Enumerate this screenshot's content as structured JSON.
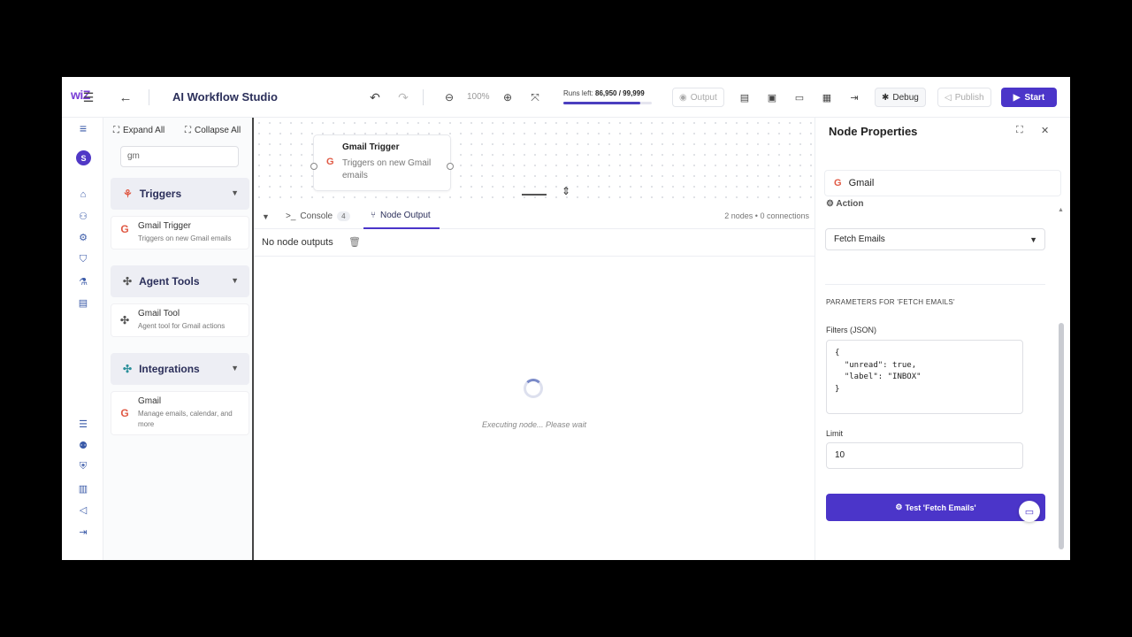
{
  "header": {
    "logo": "wiZ",
    "title": "AI Workflow Studio",
    "zoom": "100%",
    "runs_label": "Runs left:",
    "runs_value": "86,950 / 99,999",
    "runs_fraction": 0.87,
    "output_label": "Output",
    "debug_label": "Debug",
    "publish_label": "Publish",
    "start_label": "Start"
  },
  "rail": {
    "avatar_letter": "S"
  },
  "library": {
    "expand_all": "Expand All",
    "collapse_all": "Collapse All",
    "search_value": "gm",
    "categories": [
      {
        "label": "Triggers",
        "item_name": "Gmail Trigger",
        "item_desc": "Triggers on new Gmail emails"
      },
      {
        "label": "Agent Tools",
        "item_name": "Gmail Tool",
        "item_desc": "Agent tool for Gmail actions"
      },
      {
        "label": "Integrations",
        "item_name": "Gmail",
        "item_desc": "Manage emails, calendar, and more"
      }
    ]
  },
  "canvas": {
    "node_title": "Gmail Trigger",
    "node_desc": "Triggers on new Gmail emails"
  },
  "bottom": {
    "console_tab": "Console",
    "console_count": "4",
    "output_tab": "Node Output",
    "stats": "2 nodes • 0 connections",
    "no_outputs": "No node outputs",
    "executing": "Executing node... Please wait"
  },
  "props": {
    "title": "Node Properties",
    "node_name": "Gmail",
    "action_label": "Action",
    "action_value": "Fetch Emails",
    "params_header": "PARAMETERS FOR 'FETCH EMAILS'",
    "filters_label": "Filters (JSON)",
    "filters_value": "{\n  \"unread\": true,\n  \"label\": \"INBOX\"\n}",
    "limit_label": "Limit",
    "limit_value": "10",
    "test_label": "Test 'Fetch Emails'"
  },
  "colors": {
    "accent": "#4b35c9",
    "gmail_red": "#e05a45"
  }
}
